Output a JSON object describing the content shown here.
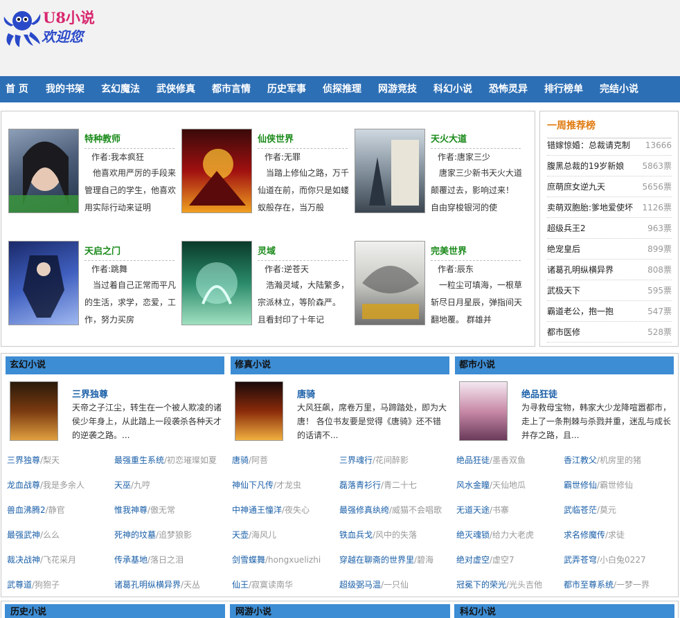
{
  "header": {
    "logo_title": "U8小说",
    "logo_sub": "欢迎您"
  },
  "nav": [
    "首 页",
    "我的书架",
    "玄幻魔法",
    "武侠修真",
    "都市言情",
    "历史军事",
    "侦探推理",
    "网游竞技",
    "科幻小说",
    "恐怖灵异",
    "排行榜单",
    "完结小说"
  ],
  "featured": [
    {
      "title": "特种教师",
      "author": "作者:我本疯狂",
      "desc": "他喜欢用严厉的手段来管理自己的学生，他喜欢用实际行动来证明"
    },
    {
      "title": "仙侠世界",
      "author": "作者:无罪",
      "desc": "当踏上修仙之路，万千仙道在前，而你只是如蝼蚁般存在，当万般"
    },
    {
      "title": "天火大道",
      "author": "作者:唐家三少",
      "desc": "唐家三少新书天火大道 颠覆过去，影响过来！ 自由穿梭银河的使"
    },
    {
      "title": "天启之门",
      "author": "作者:跳舞",
      "desc": "当过着自己正常而平凡的生活，求学，恋爱，工作，努力买房"
    },
    {
      "title": "灵域",
      "author": "作者:逆苍天",
      "desc": "浩瀚灵域，大陆繁多，宗派林立，等阶森严。 且看封印了十年记"
    },
    {
      "title": "完美世界",
      "author": "作者:辰东",
      "desc": "一粒尘可填海，一根草斩尽日月星辰，弹指间天翻地覆。 群雄并"
    }
  ],
  "ranking": {
    "title": "一周推荐榜",
    "items": [
      {
        "name": "错嫁惊婚：总裁请克制",
        "votes": "13666"
      },
      {
        "name": "腹黑总裁的19岁新娘",
        "votes": "5863票"
      },
      {
        "name": "庶萌庶女逆九天",
        "votes": "5656票"
      },
      {
        "name": "卖萌双胞胎:爹地爱使坏",
        "votes": "1126票"
      },
      {
        "name": "超级兵王2",
        "votes": "963票"
      },
      {
        "name": "绝宠皇后",
        "votes": "899票"
      },
      {
        "name": "诸葛孔明纵横异界",
        "votes": "808票"
      },
      {
        "name": "武极天下",
        "votes": "595票"
      },
      {
        "name": "霸道老公，抱一抱",
        "votes": "547票"
      },
      {
        "name": "都市医修",
        "votes": "528票"
      }
    ]
  },
  "categories": [
    {
      "name": "玄幻小说",
      "feat_title": "三界独尊",
      "feat_desc": "天帝之子江尘，转生在一个被人欺凌的诸侯少年身上，从此踏上一段袭杀各种天才的逆袭之路。...",
      "list": [
        {
          "title": "三界独尊",
          "author": "/梨天"
        },
        {
          "title": "最强重生系统",
          "author": "/初恋璀璨如夏"
        },
        {
          "title": "龙血战尊",
          "author": "/我是多余人"
        },
        {
          "title": "天巫",
          "author": "/九哼"
        },
        {
          "title": "兽血沸腾2",
          "author": "/静官"
        },
        {
          "title": "惟我神尊",
          "author": "/傲无常"
        },
        {
          "title": "最强武神",
          "author": "/么么"
        },
        {
          "title": "死神的坟墓",
          "author": "/追梦狼影"
        },
        {
          "title": "裁决战神",
          "author": "/飞花采月"
        },
        {
          "title": "传承基地",
          "author": "/落日之泪"
        },
        {
          "title": "武尊道",
          "author": "/狗狍子"
        },
        {
          "title": "诸葛孔明纵横异界",
          "author": "/天丛"
        }
      ]
    },
    {
      "name": "修真小说",
      "feat_title": "唐骑",
      "feat_desc": "大风狂飙，席卷万里，马蹄踏处，即为大唐！ 各位书友要是觉得《唐骑》还不错的话请不...",
      "list": [
        {
          "title": "唐骑",
          "author": "/阿菩"
        },
        {
          "title": "三界魂行",
          "author": "/花间醉影"
        },
        {
          "title": "神仙下凡传",
          "author": "/才龙虫"
        },
        {
          "title": "磊落青衫行",
          "author": "/青二十七"
        },
        {
          "title": "中神通王憧洋",
          "author": "/夜失心"
        },
        {
          "title": "最强修真纨绔",
          "author": "/威猫不会唱歌"
        },
        {
          "title": "天壶",
          "author": "/海风儿"
        },
        {
          "title": "铁血兵戈",
          "author": "/风中的失落"
        },
        {
          "title": "剑雪蝶舞",
          "author": "/hongxuelizhi"
        },
        {
          "title": "穿越在聊斋的世界里",
          "author": "/碧海"
        },
        {
          "title": "仙王",
          "author": "/寂寞读南华"
        },
        {
          "title": "超级弼马温",
          "author": "/一只仙"
        }
      ]
    },
    {
      "name": "都市小说",
      "feat_title": "绝品狂徒",
      "feat_desc": "为寻救母宝物，韩家大少龙降喧嚣都市，走上了一条荆棘与杀戮并重，迷乱与成长并存之路，且...",
      "list": [
        {
          "title": "绝品狂徒",
          "author": "/墨香双鱼"
        },
        {
          "title": "香江教父",
          "author": "/机房里的猪"
        },
        {
          "title": "风水金瞳",
          "author": "/天仙地瓜"
        },
        {
          "title": "霸世修仙",
          "author": "/霸世修仙"
        },
        {
          "title": "无道天途",
          "author": "/书寨"
        },
        {
          "title": "武临苍茫",
          "author": "/莫元"
        },
        {
          "title": "绝灭魂锁",
          "author": "/给力大老虎"
        },
        {
          "title": "求名修魔传",
          "author": "/求徒"
        },
        {
          "title": "绝对虚空",
          "author": "/虚空7"
        },
        {
          "title": "武弄苍穹",
          "author": "/小白兔0227"
        },
        {
          "title": "冠冕下的荣光",
          "author": "/光头吉他"
        },
        {
          "title": "都市至尊系统",
          "author": "/一梦一界"
        }
      ]
    }
  ],
  "bottom_sections": [
    "历史小说",
    "网游小说",
    "科幻小说"
  ]
}
